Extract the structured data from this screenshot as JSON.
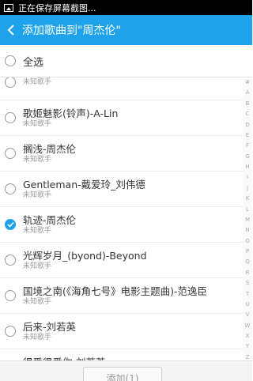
{
  "status_bar": {
    "text": "正在保存屏幕截图..."
  },
  "header": {
    "title": "添加歌曲到\"周杰伦\""
  },
  "select_all": {
    "label": "全选"
  },
  "songs": [
    {
      "title": "",
      "artist": "未知歌手",
      "selected": false
    },
    {
      "title": "歌姬魅影(铃声)-A-Lin",
      "artist": "未知歌手",
      "selected": false
    },
    {
      "title": "搁浅-周杰伦",
      "artist": "未知歌手",
      "selected": false
    },
    {
      "title": "Gentleman-戴爱玲_刘伟德",
      "artist": "未知歌手",
      "selected": false
    },
    {
      "title": "轨迹-周杰伦",
      "artist": "未知歌手",
      "selected": true
    },
    {
      "title": "光辉岁月_(byond)-Beyond",
      "artist": "未知歌手",
      "selected": false
    },
    {
      "title": "国境之南(《海角七号》电影主题曲)-范逸臣",
      "artist": "未知歌手",
      "selected": false
    },
    {
      "title": "后来-刘若英",
      "artist": "未知歌手",
      "selected": false
    },
    {
      "title": "很爱很爱你-刘若英",
      "artist": "未知歌手",
      "selected": false
    }
  ],
  "alpha_index": [
    "#",
    "A",
    "B",
    "C",
    "D",
    "E",
    "F",
    "G",
    "H",
    "I",
    "J",
    "K",
    "L",
    "M",
    "N",
    "O",
    "P",
    "Q",
    "R",
    "S",
    "T",
    "U",
    "V",
    "W",
    "X",
    "Y",
    "Z"
  ],
  "footer": {
    "add_button": "添加(1)"
  },
  "colors": {
    "accent": "#1fa2ec",
    "status_bar": "#000000"
  }
}
